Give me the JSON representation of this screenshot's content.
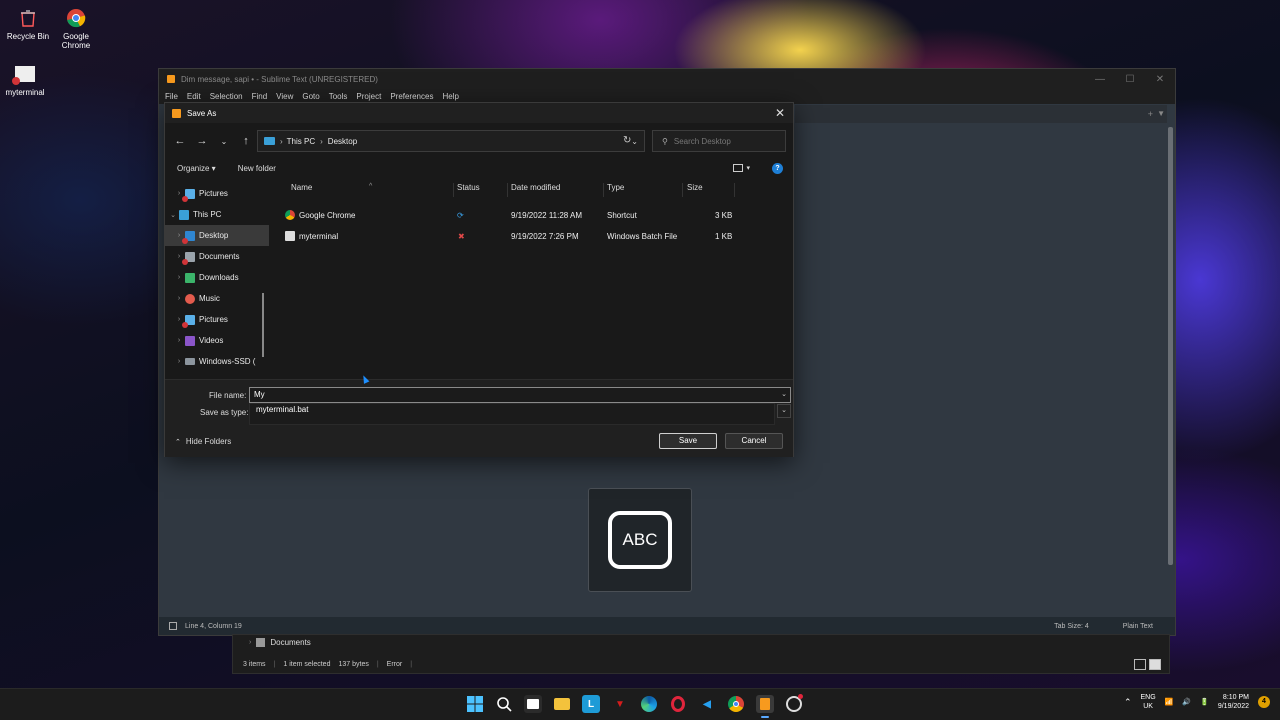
{
  "desktop": {
    "icons": [
      {
        "label": "Recycle Bin",
        "icon": "recycle-bin-icon"
      },
      {
        "label": "Google Chrome",
        "icon": "chrome-icon"
      },
      {
        "label": "myterminal",
        "icon": "batch-file-icon"
      }
    ]
  },
  "sublime": {
    "title": "Dim message, sapi • - Sublime Text (UNREGISTERED)",
    "menu": [
      "File",
      "Edit",
      "Selection",
      "Find",
      "View",
      "Goto",
      "Tools",
      "Project",
      "Preferences",
      "Help"
    ],
    "status_left": "Line 4, Column 19",
    "tab_size": "Tab Size: 4",
    "syntax": "Plain Text"
  },
  "overlay": {
    "text": "ABC"
  },
  "explorer_behind": {
    "folder": "Documents",
    "items": "3 items",
    "selected": "1 item selected",
    "size": "137 bytes",
    "error": "Error"
  },
  "dialog": {
    "title": "Save As",
    "breadcrumb": [
      "This PC",
      "Desktop"
    ],
    "search_placeholder": "Search Desktop",
    "organize": "Organize ▾",
    "new_folder": "New folder",
    "nav_items": [
      {
        "label": "Pictures",
        "icon": "pictures-icon",
        "indent": 1
      },
      {
        "label": "This PC",
        "icon": "computer-icon",
        "indent": 0
      },
      {
        "label": "Desktop",
        "icon": "desktop-icon",
        "indent": 1,
        "selected": true
      },
      {
        "label": "Documents",
        "icon": "documents-icon",
        "indent": 1
      },
      {
        "label": "Downloads",
        "icon": "downloads-icon",
        "indent": 1
      },
      {
        "label": "Music",
        "icon": "music-icon",
        "indent": 1
      },
      {
        "label": "Pictures",
        "icon": "pictures-icon",
        "indent": 1
      },
      {
        "label": "Videos",
        "icon": "videos-icon",
        "indent": 1
      },
      {
        "label": "Windows-SSD (",
        "icon": "drive-icon",
        "indent": 1
      }
    ],
    "columns": [
      "Name",
      "Status",
      "Date modified",
      "Type",
      "Size"
    ],
    "files": [
      {
        "name": "Google Chrome",
        "status_icon": "sync-icon",
        "date": "9/19/2022 11:28 AM",
        "type": "Shortcut",
        "size": "3 KB"
      },
      {
        "name": "myterminal",
        "status_icon": "error-icon",
        "date": "9/19/2022 7:26 PM",
        "type": "Windows Batch File",
        "size": "1 KB"
      }
    ],
    "file_name_label": "File name:",
    "file_name_value": "My",
    "save_as_type_label": "Save as type:",
    "suggestion": "myterminal.bat",
    "hide_folders": "Hide Folders",
    "save": "Save",
    "cancel": "Cancel"
  },
  "taskbar": {
    "apps": [
      "start",
      "search",
      "store",
      "file-explorer",
      "libreoffice",
      "mcafee",
      "edge",
      "opera",
      "vscode",
      "chrome",
      "sublime",
      "obs"
    ],
    "lang_top": "ENG",
    "lang_bottom": "UK",
    "time": "8:10 PM",
    "date": "9/19/2022",
    "notification_count": "4"
  }
}
